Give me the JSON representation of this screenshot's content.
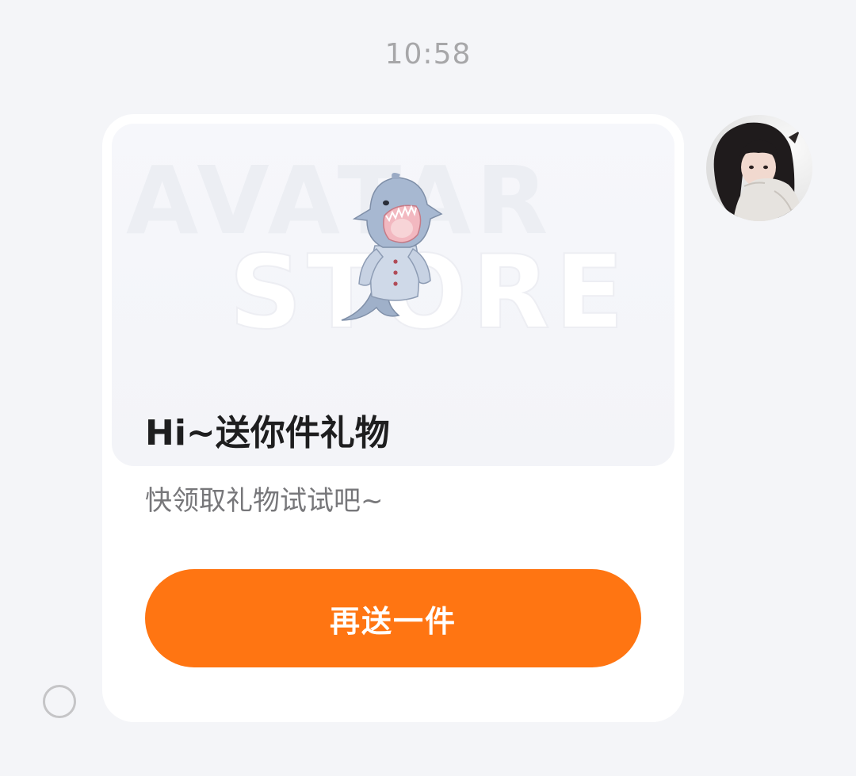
{
  "message": {
    "timestamp": "10:58"
  },
  "gift_card": {
    "banner_watermark_line1": "AVATAR",
    "banner_watermark_line2": "STORE",
    "illustration_icon": "shark-costume-avatar-icon",
    "title": "Hi~送你件礼物",
    "subtitle": "快领取礼物试试吧~",
    "button_label": "再送一件"
  },
  "sender": {
    "avatar_icon": "user-avatar-photo"
  },
  "status": {
    "icon": "message-status-circle-icon"
  },
  "colors": {
    "background": "#f4f5f8",
    "card": "#ffffff",
    "accent": "#ff7512",
    "timestamp_text": "#a7a7a9",
    "title_text": "#1e1e1f",
    "subtitle_text": "#77777a"
  }
}
